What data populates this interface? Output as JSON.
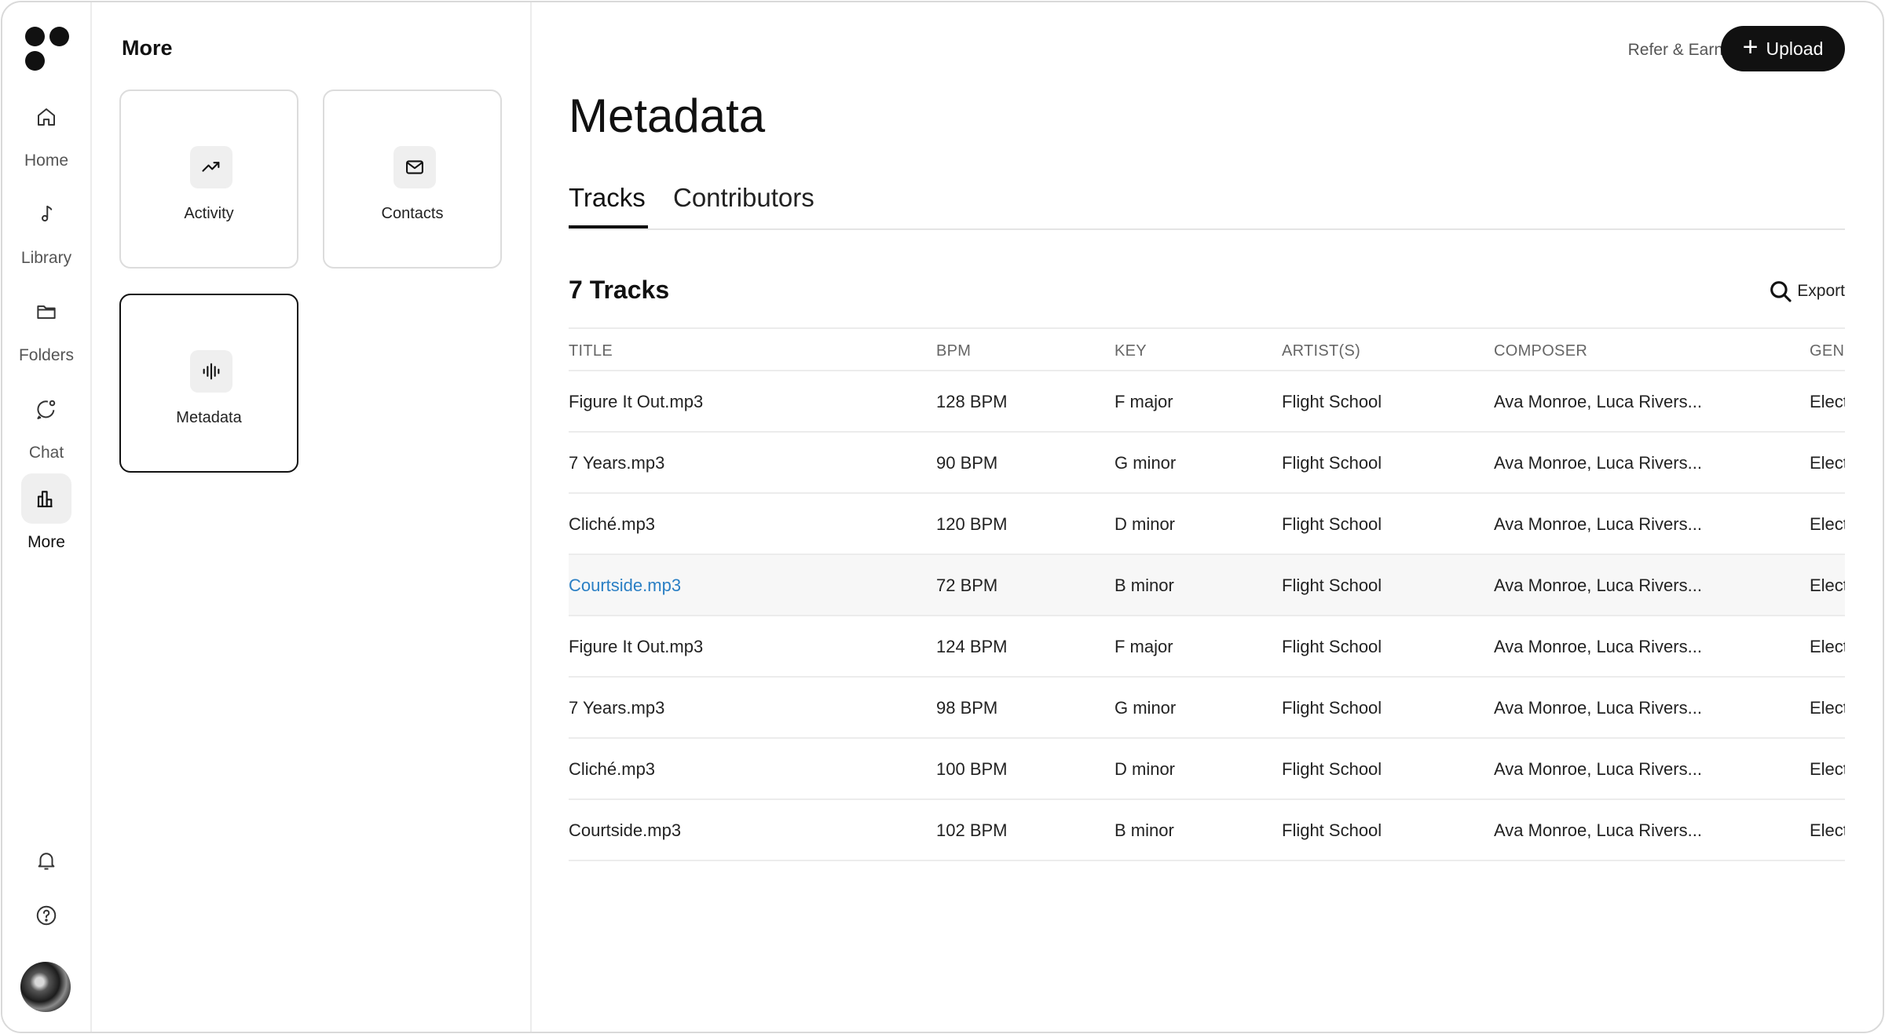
{
  "rail": {
    "items": [
      {
        "label": "Home",
        "icon": "home-icon"
      },
      {
        "label": "Library",
        "icon": "music-note-icon"
      },
      {
        "label": "Folders",
        "icon": "folder-icon"
      },
      {
        "label": "Chat",
        "icon": "chat-icon"
      },
      {
        "label": "More",
        "icon": "bar-chart-icon",
        "active": true
      }
    ],
    "bottom_icons": [
      "bell-icon",
      "help-icon"
    ]
  },
  "panel": {
    "title": "More",
    "cards": [
      {
        "label": "Activity",
        "icon": "trend-up-icon"
      },
      {
        "label": "Contacts",
        "icon": "mail-icon"
      },
      {
        "label": "Metadata",
        "icon": "waveform-icon",
        "selected": true
      }
    ]
  },
  "header": {
    "refer_label": "Refer & Earn",
    "upload_label": "Upload"
  },
  "main": {
    "title": "Metadata",
    "tabs": [
      {
        "label": "Tracks",
        "active": true
      },
      {
        "label": "Contributors"
      }
    ],
    "count_label": "7 Tracks",
    "export_label": "Export"
  },
  "table": {
    "columns": [
      "TITLE",
      "BPM",
      "KEY",
      "ARTIST(S)",
      "COMPOSER",
      "GENR"
    ],
    "rows": [
      {
        "title": "Figure It Out.mp3",
        "bpm": "128 BPM",
        "key": "F major",
        "artist": "Flight School",
        "composer": "Ava Monroe, Luca Rivers...",
        "genre": "Elect"
      },
      {
        "title": "7 Years.mp3",
        "bpm": "90 BPM",
        "key": "G minor",
        "artist": "Flight School",
        "composer": "Ava Monroe, Luca Rivers...",
        "genre": "Elect"
      },
      {
        "title": "Cliché.mp3",
        "bpm": "120 BPM",
        "key": "D minor",
        "artist": "Flight School",
        "composer": "Ava Monroe, Luca Rivers...",
        "genre": "Elect"
      },
      {
        "title": "Courtside.mp3",
        "bpm": "72 BPM",
        "key": "B minor",
        "artist": "Flight School",
        "composer": "Ava Monroe, Luca Rivers...",
        "genre": "Elect",
        "hover": true
      },
      {
        "title": "Figure It Out.mp3",
        "bpm": "124 BPM",
        "key": "F major",
        "artist": "Flight School",
        "composer": "Ava Monroe, Luca Rivers...",
        "genre": "Elect"
      },
      {
        "title": "7 Years.mp3",
        "bpm": "98 BPM",
        "key": "G minor",
        "artist": "Flight School",
        "composer": "Ava Monroe, Luca Rivers...",
        "genre": "Elect"
      },
      {
        "title": "Cliché.mp3",
        "bpm": "100 BPM",
        "key": "D minor",
        "artist": "Flight School",
        "composer": "Ava Monroe, Luca Rivers...",
        "genre": "Elect"
      },
      {
        "title": "Courtside.mp3",
        "bpm": "102 BPM",
        "key": "B minor",
        "artist": "Flight School",
        "composer": "Ava Monroe, Luca Rivers...",
        "genre": "Elect"
      }
    ]
  },
  "colors": {
    "accent": "#111111",
    "link": "#2a7fc4",
    "hover_row": "#f7f7f7"
  }
}
